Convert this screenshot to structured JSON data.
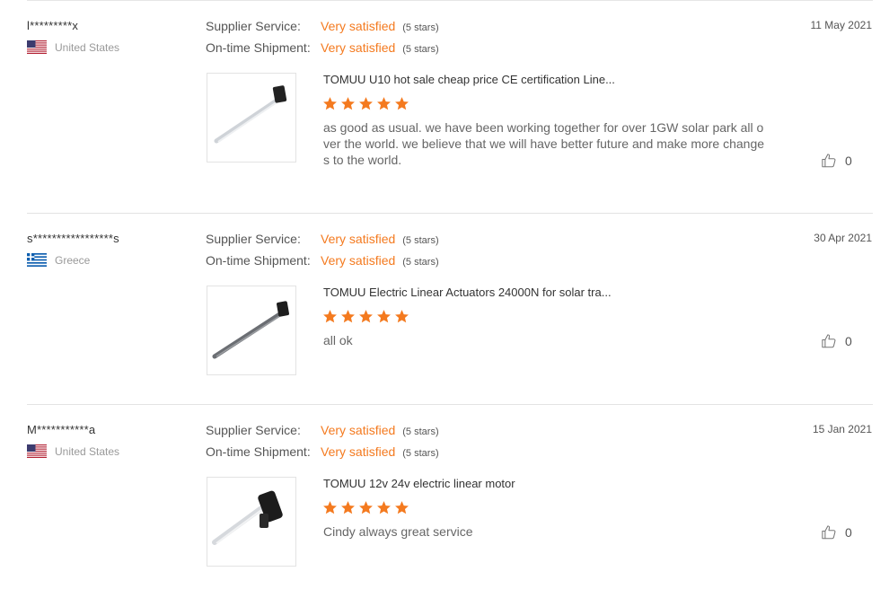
{
  "colors": {
    "accent": "#f47a1f",
    "divider": "#e3e3e3",
    "star": "#f47a1f"
  },
  "criteria": {
    "supplier_label": "Supplier Service:",
    "shipment_label": "On-time Shipment:"
  },
  "reviews": [
    {
      "user": "l*********x",
      "country": "United States",
      "flag_icon": "flag-us-icon",
      "date": "11 May 2021",
      "supplier_value": "Very satisfied",
      "supplier_stars": "(5 stars)",
      "shipment_value": "Very satisfied",
      "shipment_stars": "(5 stars)",
      "product_title": "TOMUU U10 hot sale cheap price CE certification Line...",
      "product_rating": 5,
      "comment": "as good as usual. we have been working together for over 1GW solar park all over the world. we believe that we will have better future and make more changes to the world.",
      "likes": "0"
    },
    {
      "user": "s*****************s",
      "country": "Greece",
      "flag_icon": "flag-greece-icon",
      "date": "30 Apr 2021",
      "supplier_value": "Very satisfied",
      "supplier_stars": "(5 stars)",
      "shipment_value": "Very satisfied",
      "shipment_stars": "(5 stars)",
      "product_title": "TOMUU Electric Linear Actuators 24000N for solar tra...",
      "product_rating": 5,
      "comment": "all ok",
      "likes": "0"
    },
    {
      "user": "M***********a",
      "country": "United States",
      "flag_icon": "flag-us-icon",
      "date": "15 Jan 2021",
      "supplier_value": "Very satisfied",
      "supplier_stars": "(5 stars)",
      "shipment_value": "Very satisfied",
      "shipment_stars": "(5 stars)",
      "product_title": "TOMUU 12v 24v electric linear motor",
      "product_rating": 5,
      "comment": "Cindy always great service",
      "likes": "0"
    }
  ]
}
